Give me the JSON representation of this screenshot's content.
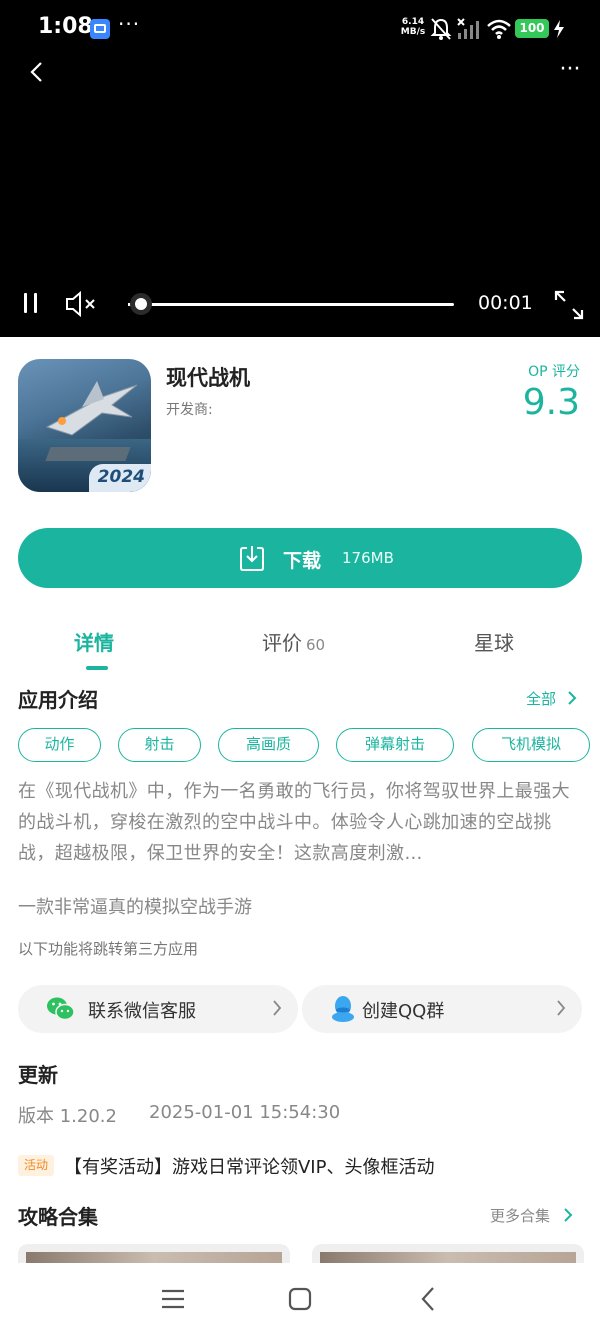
{
  "status_bar": {
    "time": "1:08",
    "dots": "···",
    "net_speed_value": "6.14",
    "net_speed_unit": "MB/s",
    "battery": "100"
  },
  "video": {
    "current_time": "00:01",
    "progress_fraction": 0.04
  },
  "app": {
    "name": "现代战机",
    "developer": "开发商:",
    "score_label": "OP 评分",
    "score": "9.3",
    "icon_badge": "2024"
  },
  "download": {
    "label": "下载",
    "size": "176MB"
  },
  "tabs": [
    {
      "label": "详情",
      "count": ""
    },
    {
      "label": "评价",
      "count": "60"
    },
    {
      "label": "星球",
      "count": ""
    }
  ],
  "intro": {
    "title": "应用介绍",
    "all_link": "全部",
    "tags": [
      "动作",
      "射击",
      "高画质",
      "弹幕射击",
      "飞机模拟"
    ],
    "description": "在《现代战机》中，作为一名勇敢的飞行员，你将驾驭世界上最强大的战斗机，穿梭在激烈的空中战斗中。体验令人心跳加速的空战挑战，超越极限，保卫世界的安全！这款高度刺激…",
    "tagline": "一款非常逼真的模拟空战手游",
    "third_party_note": "以下功能将跳转第三方应用"
  },
  "services": [
    {
      "label": "联系微信客服",
      "icon": "wechat-icon"
    },
    {
      "label": "创建QQ群",
      "icon": "qq-icon"
    }
  ],
  "update": {
    "title": "更新",
    "version": "版本 1.20.2",
    "time": "2025-01-01 15:54:30"
  },
  "activity": {
    "badge": "活动",
    "text": "【有奖活动】游戏日常评论领VIP、头像框活动"
  },
  "guides": {
    "title": "攻略合集",
    "more_link": "更多合集"
  },
  "colors": {
    "accent": "#1bb59f",
    "activity_badge": "#f08a24"
  }
}
